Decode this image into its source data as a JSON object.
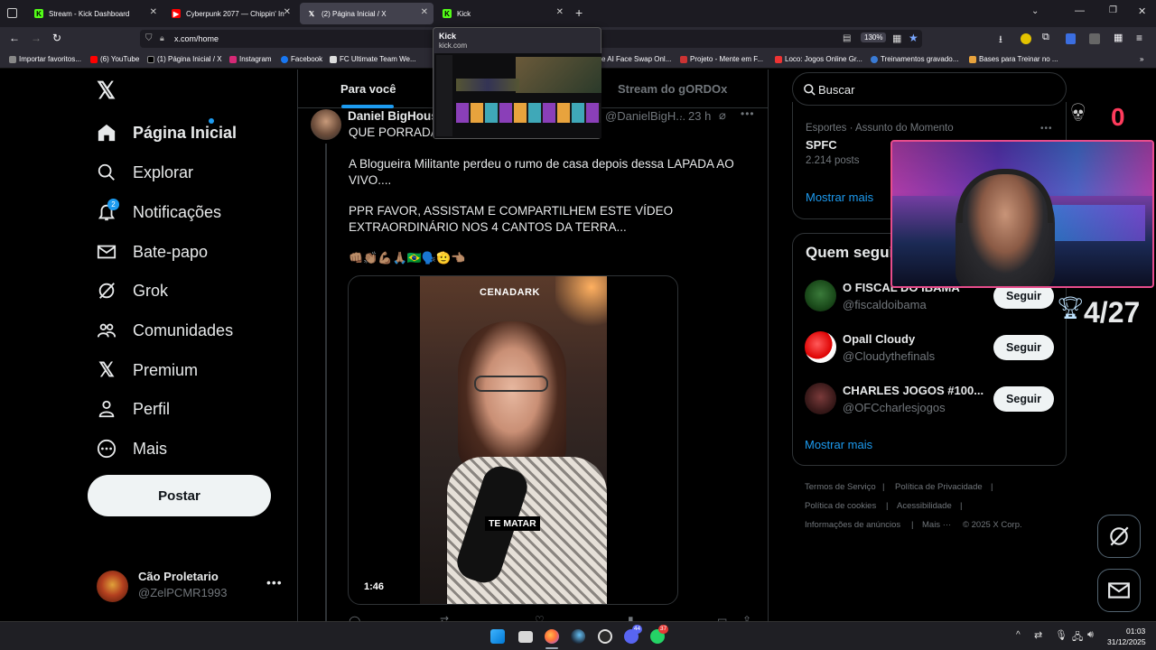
{
  "browser": {
    "tabs": [
      {
        "title": "Stream - Kick Dashboard",
        "icon": "kick-icon"
      },
      {
        "title": "Cyberpunk 2077 — Chippin' In",
        "icon": "youtube-icon"
      },
      {
        "title": "(2) Página Inicial / X",
        "icon": "x-icon"
      },
      {
        "title": "Kick",
        "icon": "kick-icon"
      }
    ],
    "url": "x.com/home",
    "zoom": "130%",
    "bookmarks": [
      "Importar favoritos...",
      "(6) YouTube",
      "(1) Página Inicial / X",
      "Instagram",
      "Facebook",
      "FC Ultimate Team We...",
      "e AI Face Swap Onl...",
      "Projeto - Mente em F...",
      "Loco: Jogos Online Gr...",
      "Treinamentos gravado...",
      "Bases para Treinar no ..."
    ],
    "tab_preview": {
      "title": "Kick",
      "url": "kick.com"
    }
  },
  "nav": {
    "items": [
      {
        "label": "Página Inicial",
        "icon": "home-icon",
        "badge": ""
      },
      {
        "label": "Explorar",
        "icon": "search-icon",
        "badge": ""
      },
      {
        "label": "Notificações",
        "icon": "bell-icon",
        "badge": "2"
      },
      {
        "label": "Bate-papo",
        "icon": "mail-icon",
        "badge": ""
      },
      {
        "label": "Grok",
        "icon": "grok-icon",
        "badge": ""
      },
      {
        "label": "Comunidades",
        "icon": "people-icon",
        "badge": ""
      },
      {
        "label": "Premium",
        "icon": "x-icon",
        "badge": ""
      },
      {
        "label": "Perfil",
        "icon": "person-icon",
        "badge": ""
      },
      {
        "label": "Mais",
        "icon": "more-circle-icon",
        "badge": ""
      }
    ],
    "post_label": "Postar",
    "account": {
      "name": "Cão Proletario",
      "handle": "@ZelPCMR1993"
    }
  },
  "timeline": {
    "tabs": [
      "Para você",
      "Stream do gORDOx"
    ],
    "tweet": {
      "author": "Daniel BigHous",
      "handle": "@DanielBigH...",
      "time": "23 h",
      "line1": "QUE PORRADA",
      "para1": "A Blogueira Militante perdeu o rumo de casa depois dessa LAPADA AO VIVO....",
      "para2": "PPR FAVOR, ASSISTAM E COMPARTILHEM ESTE VÍDEO EXTRAORDINÁRIO NOS 4 CANTOS DA TERRA...",
      "emojis": "👊🏽👏🏽💪🏽🙏🏽🇧🇷🗣️🫡👈🏽",
      "video": {
        "watermark": "CENADARK",
        "caption": "TE MATAR",
        "duration": "1:46"
      }
    }
  },
  "sidebar": {
    "search_placeholder": "Buscar",
    "trend": {
      "context": "Esportes · Assunto do Momento",
      "title": "SPFC",
      "count": "2.214 posts"
    },
    "show_more": "Mostrar mais",
    "who_to_follow_title": "Quem seguir",
    "follow_label": "Seguir",
    "suggestions": [
      {
        "name": "O FISCAL DO IBAMA",
        "handle": "@fiscaldoibama"
      },
      {
        "name": "Opall Cloudy",
        "handle": "@Cloudythefinals"
      },
      {
        "name": "CHARLES JOGOS #100...",
        "handle": "@OFCcharlesjogos"
      }
    ],
    "show_more_2": "Mostrar mais",
    "footer": [
      "Termos de Serviço",
      "Política de Privacidade",
      "Política de cookies",
      "Acessibilidade",
      "Informações de anúncios",
      "Mais ···",
      "© 2025 X Corp."
    ]
  },
  "overlay": {
    "death_count": "0",
    "trophy_count": "4/27"
  },
  "taskbar": {
    "time": "01:03",
    "date": "31/12/2025",
    "whatsapp_badge": "37",
    "discord_badge": "44"
  }
}
